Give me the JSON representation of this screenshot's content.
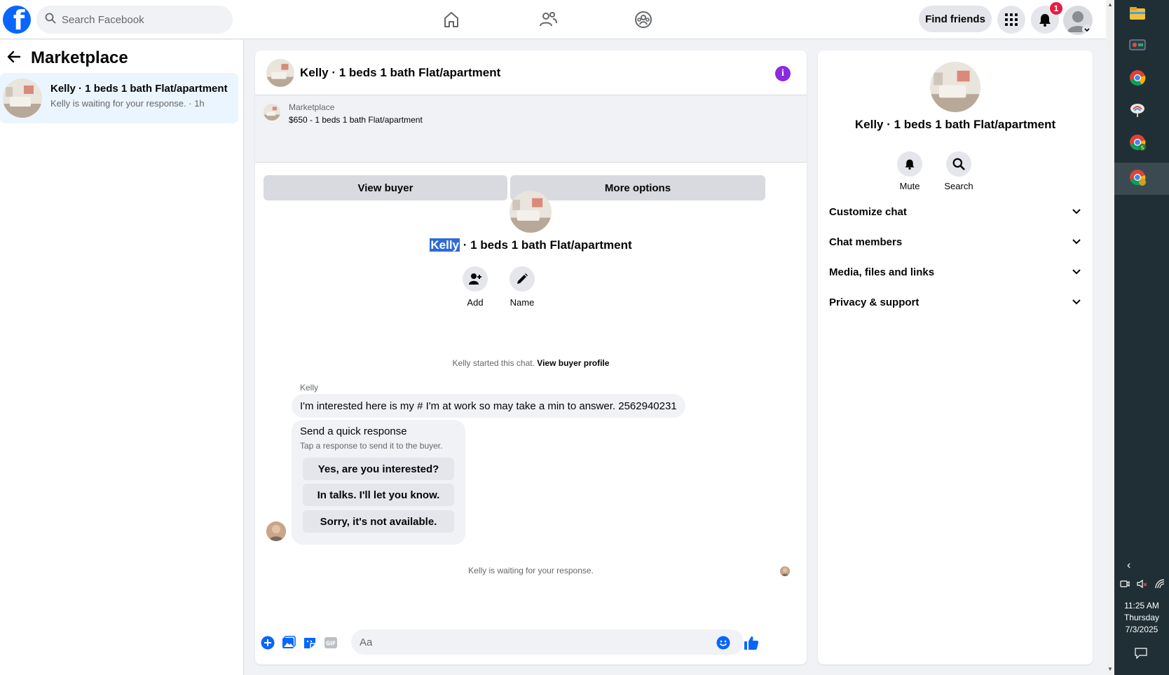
{
  "topbar": {
    "logo_letter": "f",
    "search_placeholder": "Search Facebook",
    "find_friends_label": "Find friends",
    "notification_count": "1"
  },
  "sidebar": {
    "title": "Marketplace",
    "conversations": [
      {
        "title": "Kelly · 1 beds 1 bath Flat/apartment",
        "subtitle": "Kelly is waiting for your response. · 1h"
      }
    ]
  },
  "chat": {
    "header_title": "Kelly · 1 beds 1 bath Flat/apartment",
    "info_symbol": "i",
    "listing": {
      "label": "Marketplace",
      "price_title": "$650 - 1 beds 1 bath Flat/apartment",
      "view_buyer_label": "View buyer",
      "more_options_label": "More options"
    },
    "intro": {
      "name_highlight": "Kelly",
      "title_rest": " · 1 beds 1 bath Flat/apartment",
      "add_label": "Add",
      "name_label": "Name"
    },
    "started_text": "Kelly started this chat.",
    "view_buyer_profile": "View buyer profile",
    "sender": "Kelly",
    "message": "I'm interested here is my # I'm at work so may take a min to answer.  2562940231",
    "quick_response": {
      "title": "Send a quick response",
      "subtitle": "Tap a response to send it to the buyer.",
      "options": [
        "Yes, are you interested?",
        "In talks. I'll let you know.",
        "Sorry, it's not available."
      ]
    },
    "waiting_text": "Kelly is waiting for your response.",
    "composer_placeholder": "Aa"
  },
  "info_panel": {
    "title": "Kelly · 1 beds 1 bath Flat/apartment",
    "mute_label": "Mute",
    "search_label": "Search",
    "sections": [
      "Customize chat",
      "Chat members",
      "Media, files and links",
      "Privacy & support"
    ]
  },
  "taskbar": {
    "time": "11:25 AM",
    "day": "Thursday",
    "date": "7/3/2025"
  },
  "colors": {
    "brand": "#0866ff",
    "highlight": "#2f6bd6",
    "badge": "#e41e3f",
    "info": "#8a2be2"
  }
}
